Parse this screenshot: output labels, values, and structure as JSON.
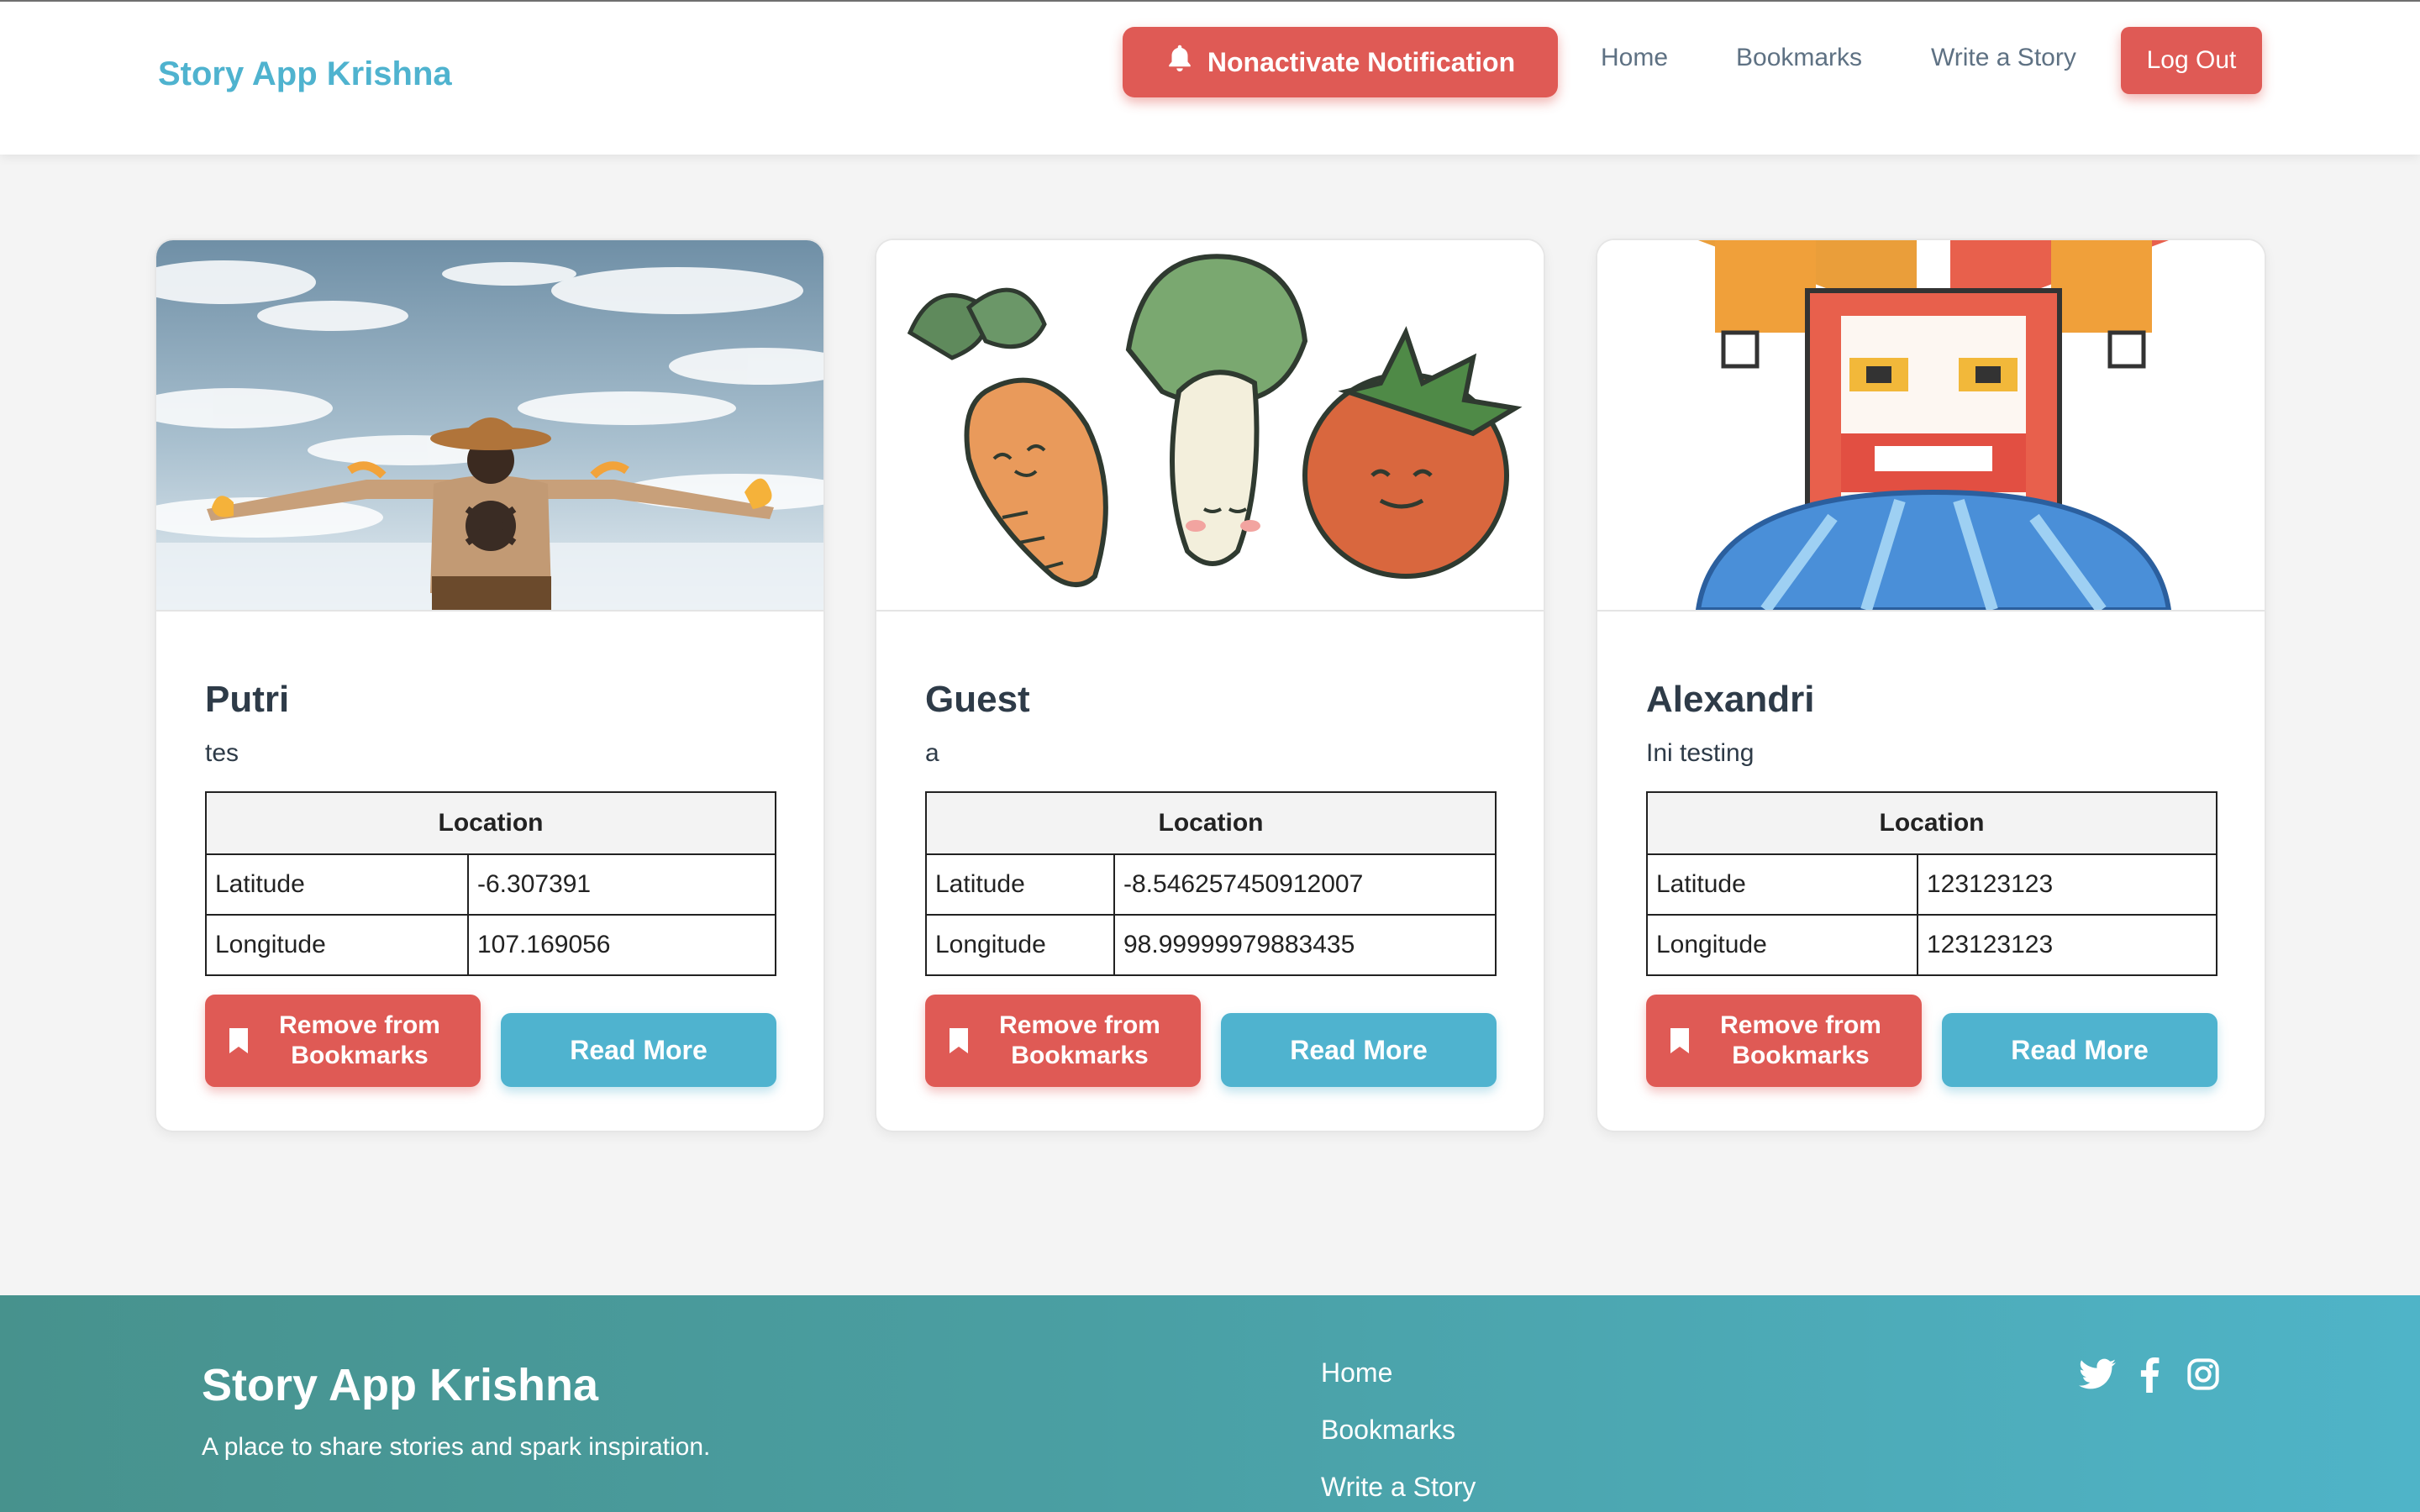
{
  "header": {
    "brand": "Story App Krishna",
    "notification_button": "Nonactivate Notification",
    "nav": [
      "Home",
      "Bookmarks",
      "Write a Story"
    ],
    "logout": "Log Out"
  },
  "cards": [
    {
      "name": "Putri",
      "description": "tes",
      "location_header": "Location",
      "latitude_label": "Latitude",
      "latitude": "-6.307391",
      "longitude_label": "Longitude",
      "longitude": "107.169056",
      "remove_label": "Remove from Bookmarks",
      "read_label": "Read More"
    },
    {
      "name": "Guest",
      "description": "a",
      "location_header": "Location",
      "latitude_label": "Latitude",
      "latitude": "-8.546257450912007",
      "longitude_label": "Longitude",
      "longitude": "98.99999979883435",
      "remove_label": "Remove from Bookmarks",
      "read_label": "Read More"
    },
    {
      "name": "Alexandri",
      "description": "Ini testing",
      "location_header": "Location",
      "latitude_label": "Latitude",
      "latitude": "123123123",
      "longitude_label": "Longitude",
      "longitude": "123123123",
      "remove_label": "Remove from Bookmarks",
      "read_label": "Read More"
    }
  ],
  "footer": {
    "brand": "Story App Krishna",
    "tagline": "A place to share stories and spark inspiration.",
    "links": [
      "Home",
      "Bookmarks",
      "Write a Story"
    ],
    "social_icons": [
      "twitter-icon",
      "facebook-icon",
      "instagram-icon"
    ]
  },
  "colors": {
    "accent_red": "#df5a55",
    "accent_blue": "#4fb3cf",
    "footer_start": "#47928d",
    "footer_end": "#4fb4c8"
  }
}
